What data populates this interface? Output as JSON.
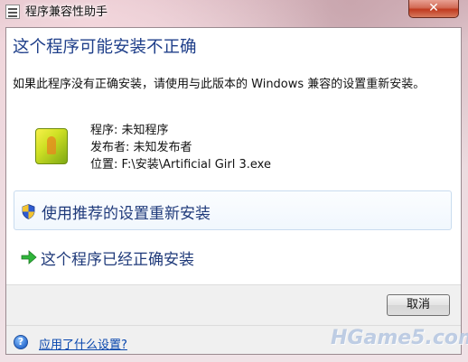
{
  "window": {
    "title": "程序兼容性助手",
    "close_label": "✕"
  },
  "dialog": {
    "heading": "这个程序可能安装不正确",
    "description": "如果此程序没有正确安装，请使用与此版本的 Windows 兼容的设置重新安装。",
    "program_line": "程序: 未知程序",
    "publisher_line": "发布者: 未知发布者",
    "location_line": "位置: F:\\安装\\Artificial Girl 3.exe"
  },
  "options": [
    {
      "label": "使用推荐的设置重新安装",
      "icon": "uac-shield-icon"
    },
    {
      "label": "这个程序已经正确安装",
      "icon": "green-arrow-icon"
    }
  ],
  "footer": {
    "cancel_label": "取消",
    "help_link": "应用了什么设置?"
  },
  "watermark": "HGame5.com",
  "colors": {
    "heading": "#1f3f8a",
    "link": "#0645ad",
    "option_text": "#1f3a7a",
    "close_button": "#c03a1f"
  }
}
